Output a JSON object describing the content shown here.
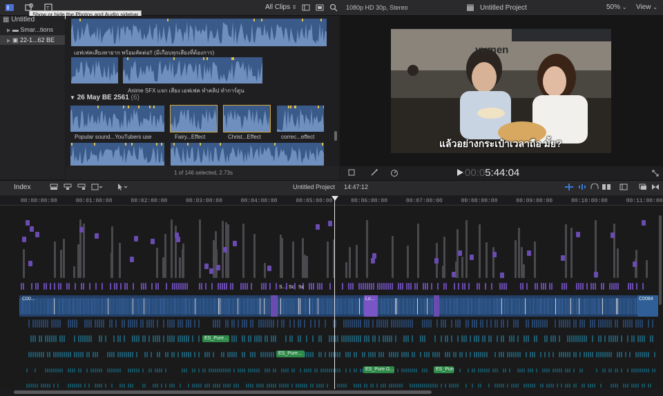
{
  "toolbar": {
    "tooltip": "Show or hide the Photos and Audio sidebar",
    "clip_filter": "All Clips",
    "format": "1080p HD 30p, Stereo",
    "project_title": "Untitled Project",
    "zoom": "50%",
    "view": "View"
  },
  "library": {
    "root": "Untitled",
    "items": [
      {
        "label": "Smar...tions"
      },
      {
        "label": "22-1...62 BE"
      }
    ]
  },
  "browser": {
    "row1_caption": "เอฟเฟคเสียงหายาก พร้อมคัตต่อ!! (มีเกือบทุกเสียงที่ต้องการ)",
    "row2_caption": "Anime SFX  แจก เสียง เอฟเฟค ทำคลิป ทำการ์ตูน",
    "group_date": "26 May BE 2561",
    "group_count": "(6)",
    "clips": [
      {
        "label": "Popular sound...YouTubers use"
      },
      {
        "label": "Fairy...Effect"
      },
      {
        "label": "Christ...Effect"
      },
      {
        "label": "correc...effect"
      }
    ],
    "status": "1 of 146 selected, 2.73s"
  },
  "viewer": {
    "subtitle": "แล้วอย่างกระเป๋าเวลาถือ มั้ย?",
    "sign_text": "yumen",
    "timecode_dim": "00:0",
    "timecode": "5:44:04"
  },
  "timeline": {
    "index_label": "Index",
    "project": "Untitled Project",
    "duration": "14:47:12",
    "ruler": [
      "00:00:00:00",
      "00:00:01:00:00",
      "00:00:02:00:00",
      "00:00:03:00:00",
      "00:00:04:00:00",
      "00:00:05:00:00",
      "00:00:06:00:00",
      "00:00:07:00:00",
      "00:00:08:00:00",
      "00:00:09:00:00",
      "00:00:10:00:00",
      "00:00:11:00:00"
    ],
    "ruler_display": [
      "00:00:00:00",
      "00:01:00:00",
      "00:02:00:00",
      "00:03:00:00",
      "00:04:00:00",
      "00:05:00:00",
      "00:06:00:00",
      "00:07:00:00",
      "00:08:00:00",
      "00:09:00:00",
      "00:10:00:00",
      "00:11:00:00"
    ],
    "green_clips": [
      "ES_Pure...",
      "ES_Pure...",
      "ES_Pure G...",
      "ES_Pure..."
    ],
    "clip_labels": [
      "C00...",
      "C0084",
      "Lo...",
      "S...",
      "Sc",
      "Sc"
    ]
  },
  "colors": {
    "accent": "#3a7bd5",
    "purple": "#6a4bb0",
    "clip_blue": "#2f5f96",
    "audio_green": "#2f8a4a",
    "selection": "#d4a93a"
  }
}
